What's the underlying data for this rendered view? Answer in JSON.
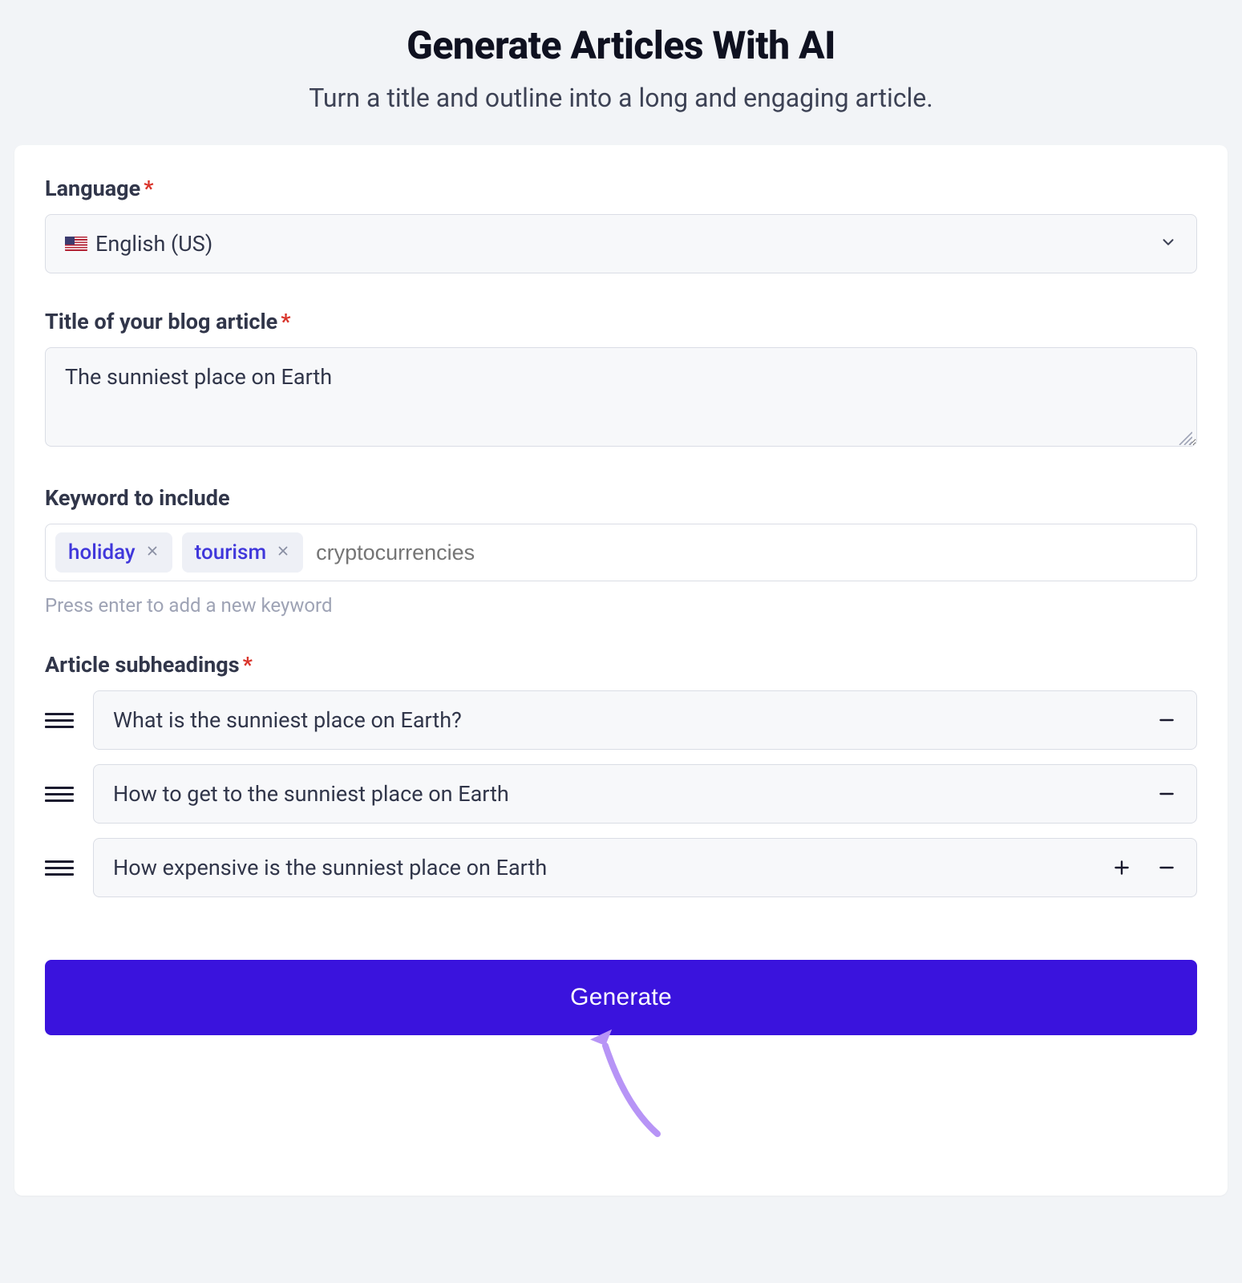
{
  "header": {
    "title": "Generate Articles With AI",
    "subtitle": "Turn a title and outline into a long and engaging article."
  },
  "form": {
    "language": {
      "label": "Language",
      "value": "English (US)"
    },
    "title": {
      "label": "Title of your blog article",
      "value": "The sunniest place on Earth"
    },
    "keywords": {
      "label": "Keyword to include",
      "tags": [
        "holiday",
        "tourism"
      ],
      "placeholder": "cryptocurrencies",
      "hint": "Press enter to add a new keyword"
    },
    "subheadings": {
      "label": "Article subheadings",
      "items": [
        {
          "text": "What is the sunniest place on Earth?",
          "showAdd": false
        },
        {
          "text": "How to get to the sunniest place on Earth",
          "showAdd": false
        },
        {
          "text": "How expensive is the sunniest place on Earth",
          "showAdd": true
        }
      ]
    },
    "submit": {
      "label": "Generate"
    }
  }
}
